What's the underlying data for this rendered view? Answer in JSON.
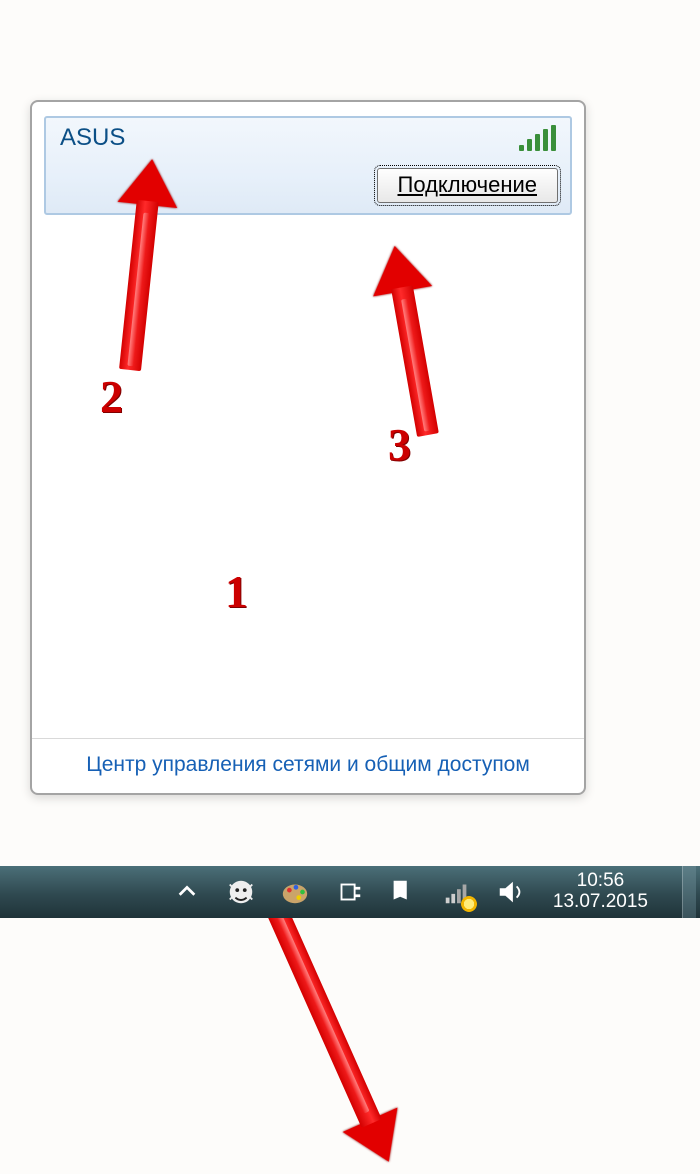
{
  "network": {
    "name": "ASUS",
    "connect_label": "Подключение"
  },
  "panel": {
    "footer_link": "Центр управления сетями и общим доступом"
  },
  "taskbar": {
    "time": "10:56",
    "date": "13.07.2015"
  },
  "annotations": {
    "n1": "1",
    "n2": "2",
    "n3": "3"
  }
}
